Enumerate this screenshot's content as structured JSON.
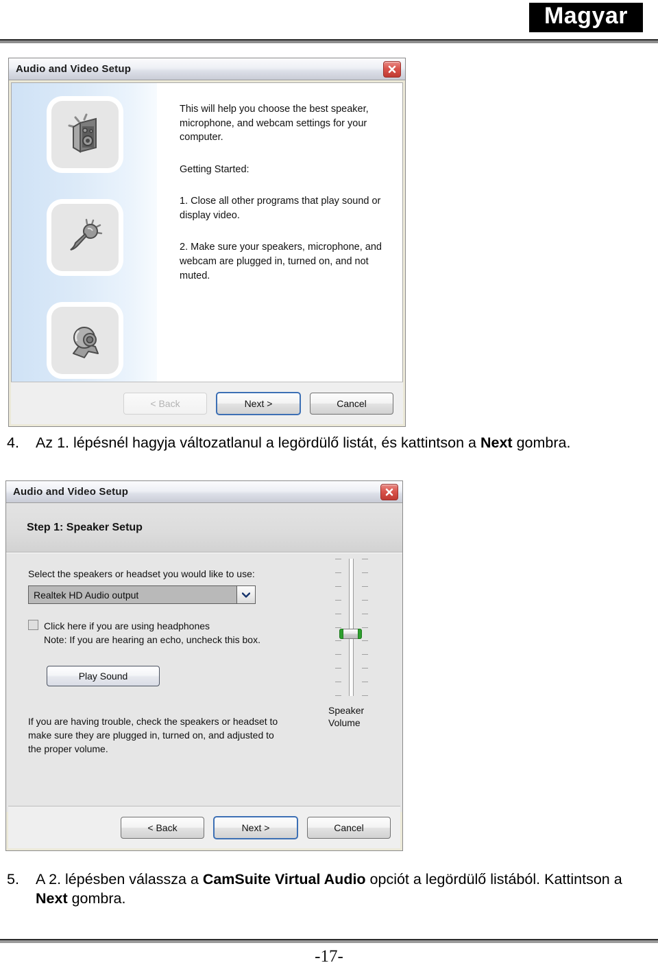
{
  "page": {
    "language_badge": "Magyar",
    "page_number": "-17-"
  },
  "dialog1": {
    "title": "Audio and Video Setup",
    "close_icon": "close-icon",
    "icons": [
      {
        "name": "speaker-icon",
        "label": "speaker"
      },
      {
        "name": "microphone-icon",
        "label": "microphone"
      },
      {
        "name": "webcam-icon",
        "label": "webcam"
      }
    ],
    "body": {
      "intro": "This will help you choose the best speaker, microphone, and webcam settings for your computer.",
      "getting_started": "Getting Started:",
      "step1": "1. Close all other programs that play sound or display video.",
      "step2": "2. Make sure your speakers, microphone, and webcam are plugged in, turned on, and not muted."
    },
    "buttons": {
      "back": "< Back",
      "next": "Next >",
      "cancel": "Cancel"
    }
  },
  "instruction4": {
    "number": "4.",
    "part1": "Az 1. lépésnél hagyja változatlanul a legördülő listát, és kattintson a ",
    "bold1": "Next",
    "part2": " gombra."
  },
  "dialog2": {
    "title": "Audio and Video Setup",
    "close_icon": "close-icon",
    "step_header": "Step 1: Speaker Setup",
    "select_label": "Select the speakers or headset you would like to use:",
    "combo": {
      "value": "Realtek HD Audio output",
      "arrow_icon": "chevron-down-icon"
    },
    "checkbox": {
      "checked": false,
      "label": "Click here if you are using headphones"
    },
    "note": "Note: If you are hearing an echo, uncheck this box.",
    "play_sound": "Play Sound",
    "trouble": "If you are having trouble, check the speakers or headset to make sure they are plugged in, turned on, and adjusted to the proper volume.",
    "volume": {
      "label_line1": "Speaker",
      "label_line2": "Volume",
      "thumb_position_percent": 55
    },
    "buttons": {
      "back": "< Back",
      "next": "Next >",
      "cancel": "Cancel"
    }
  },
  "instruction5": {
    "number": "5.",
    "part1": "A 2. lépésben válassza a ",
    "bold1": "CamSuite Virtual Audio",
    "part2": " opciót a legördülő listából. Kattintson a ",
    "bold2": "Next",
    "part3": " gombra."
  }
}
